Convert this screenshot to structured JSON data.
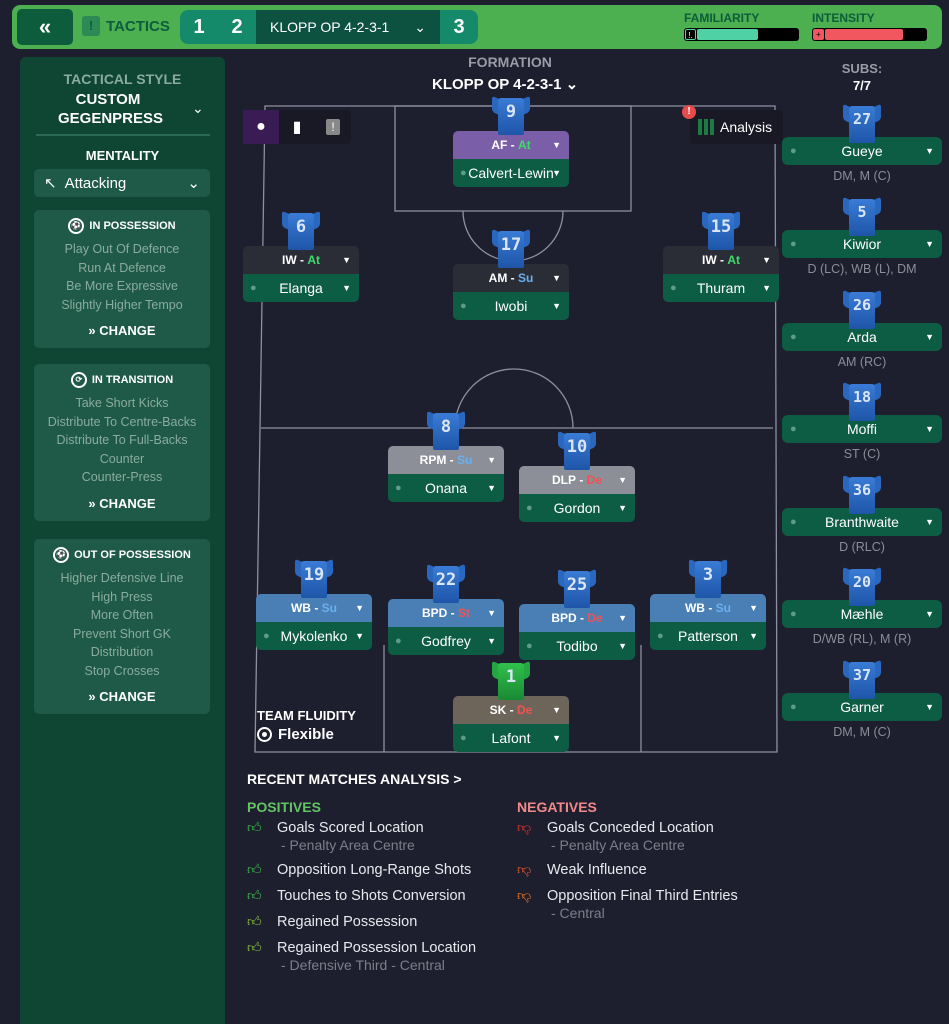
{
  "topbar": {
    "back_icon": "double-chevron-left",
    "tactics_label": "TACTICS",
    "slots": [
      "1",
      "2",
      "3"
    ],
    "selected_tactic": "KLOPP OP 4-2-3-1",
    "familiarity": {
      "label": "FAMILIARITY",
      "value": 0.6,
      "color": "#4fd1a5"
    },
    "intensity": {
      "label": "INTENSITY",
      "value": 0.77,
      "color": "#f0575f"
    }
  },
  "left_panel": {
    "tactical_style_label": "TACTICAL STYLE",
    "tactical_style": "CUSTOM GEGENPRESS",
    "mentality_label": "MENTALITY",
    "mentality": "Attacking",
    "cards": [
      {
        "title": "IN POSSESSION",
        "items": [
          "Play Out Of Defence",
          "Run At Defence",
          "Be More Expressive",
          "Slightly Higher Tempo"
        ],
        "action": "CHANGE"
      },
      {
        "title": "IN TRANSITION",
        "items": [
          "Take Short Kicks",
          "Distribute To Centre-Backs",
          "Distribute To Full-Backs",
          "Counter",
          "Counter-Press"
        ],
        "action": "CHANGE"
      },
      {
        "title": "OUT OF POSSESSION",
        "items": [
          "Higher Defensive Line",
          "High Press",
          "More Often",
          "Prevent Short GK",
          "Distribution",
          "Stop Crosses"
        ],
        "action": "CHANGE"
      }
    ]
  },
  "formation": {
    "label": "FORMATION",
    "name": "KLOPP OP 4-2-3-1"
  },
  "analysis_button": "Analysis",
  "players": [
    {
      "num": "9",
      "role": "AF",
      "duty": "At",
      "name": "Calvert-Lewin",
      "role_bg": "#7b5ea8"
    },
    {
      "num": "6",
      "role": "IW",
      "duty": "At",
      "name": "Elanga",
      "role_bg": "#2b2d36"
    },
    {
      "num": "17",
      "role": "AM",
      "duty": "Su",
      "name": "Iwobi",
      "role_bg": "#2b2d36"
    },
    {
      "num": "15",
      "role": "IW",
      "duty": "At",
      "name": "Thuram",
      "role_bg": "#2b2d36"
    },
    {
      "num": "8",
      "role": "RPM",
      "duty": "Su",
      "name": "Onana",
      "role_bg": "#8c8f97"
    },
    {
      "num": "10",
      "role": "DLP",
      "duty": "De",
      "name": "Gordon",
      "role_bg": "#8c8f97"
    },
    {
      "num": "19",
      "role": "WB",
      "duty": "Su",
      "name": "Mykolenko",
      "role_bg": "#4a7fb5"
    },
    {
      "num": "22",
      "role": "BPD",
      "duty": "St",
      "name": "Godfrey",
      "role_bg": "#4a7fb5"
    },
    {
      "num": "25",
      "role": "BPD",
      "duty": "De",
      "name": "Todibo",
      "role_bg": "#4a7fb5"
    },
    {
      "num": "3",
      "role": "WB",
      "duty": "Su",
      "name": "Patterson",
      "role_bg": "#4a7fb5"
    },
    {
      "num": "1",
      "role": "SK",
      "duty": "De",
      "name": "Lafont",
      "role_bg": "#6e655a"
    }
  ],
  "subs": {
    "label": "SUBS:",
    "count": "7/7",
    "players": [
      {
        "num": "27",
        "name": "Gueye",
        "pos": "DM, M (C)"
      },
      {
        "num": "5",
        "name": "Kiwior",
        "pos": "D (LC), WB (L), DM"
      },
      {
        "num": "26",
        "name": "Arda",
        "pos": "AM (RC)"
      },
      {
        "num": "18",
        "name": "Moffi",
        "pos": "ST (C)"
      },
      {
        "num": "36",
        "name": "Branthwaite",
        "pos": "D (RLC)"
      },
      {
        "num": "20",
        "name": "Mæhle",
        "pos": "D/WB (RL), M (R)"
      },
      {
        "num": "37",
        "name": "Garner",
        "pos": "DM, M (C)"
      }
    ]
  },
  "team_fluidity": {
    "label": "TEAM FLUIDITY",
    "value": "Flexible"
  },
  "recent_analysis": {
    "title": "RECENT MATCHES ANALYSIS >",
    "positives_label": "POSITIVES",
    "negatives_label": "NEGATIVES",
    "positives": [
      {
        "text": "Goals Scored Location",
        "sub": "- Penalty Area Centre",
        "color": "#3bbf4a"
      },
      {
        "text": "Opposition Long-Range Shots",
        "sub": "",
        "color": "#3bbf4a"
      },
      {
        "text": "Touches to Shots Conversion",
        "sub": "",
        "color": "#3bbf4a"
      },
      {
        "text": "Regained Possession",
        "sub": "",
        "color": "#8cc63f"
      },
      {
        "text": "Regained Possession Location",
        "sub": "- Defensive Third - Central",
        "color": "#8cc63f"
      }
    ],
    "negatives": [
      {
        "text": "Goals Conceded Location",
        "sub": "- Penalty Area Centre",
        "color": "#e53935"
      },
      {
        "text": "Weak Influence",
        "sub": "",
        "color": "#ef5a2a"
      },
      {
        "text": "Opposition Final Third Entries",
        "sub": "- Central",
        "color": "#f07a2a"
      }
    ]
  }
}
